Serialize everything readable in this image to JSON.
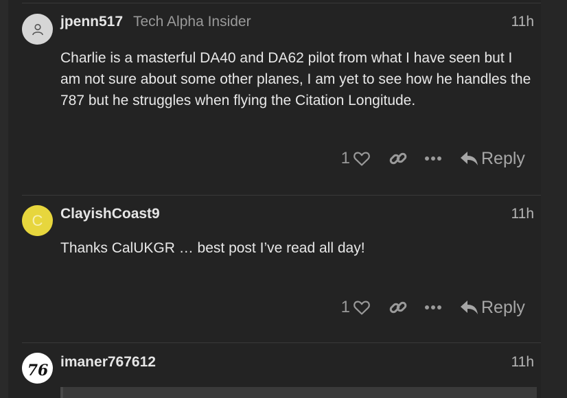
{
  "posts": [
    {
      "username": "jpenn517",
      "user_title": "Tech Alpha Insider",
      "age": "11h",
      "avatar_icon": "user-silhouette-icon",
      "body": "Charlie is a masterful DA40 and DA62 pilot from what I have seen but I am not sure about some other planes, I am yet to see how he handles the 787 but he struggles when flying the Citation Longitude.",
      "likes": "1",
      "reply_label": "Reply"
    },
    {
      "username": "ClayishCoast9",
      "user_title": "",
      "age": "11h",
      "avatar_letter": "C",
      "avatar_color": "#e7d63d",
      "body": "Thanks CalUKGR … best post I’ve read all day!",
      "likes": "1",
      "reply_label": "Reply"
    },
    {
      "username": "imaner767612",
      "user_title": "",
      "age": "11h",
      "avatar_logo": "76"
    }
  ],
  "icons": {
    "like": "heart-icon",
    "link": "link-icon",
    "more": "ellipsis-icon",
    "reply": "reply-arrow-icon"
  }
}
